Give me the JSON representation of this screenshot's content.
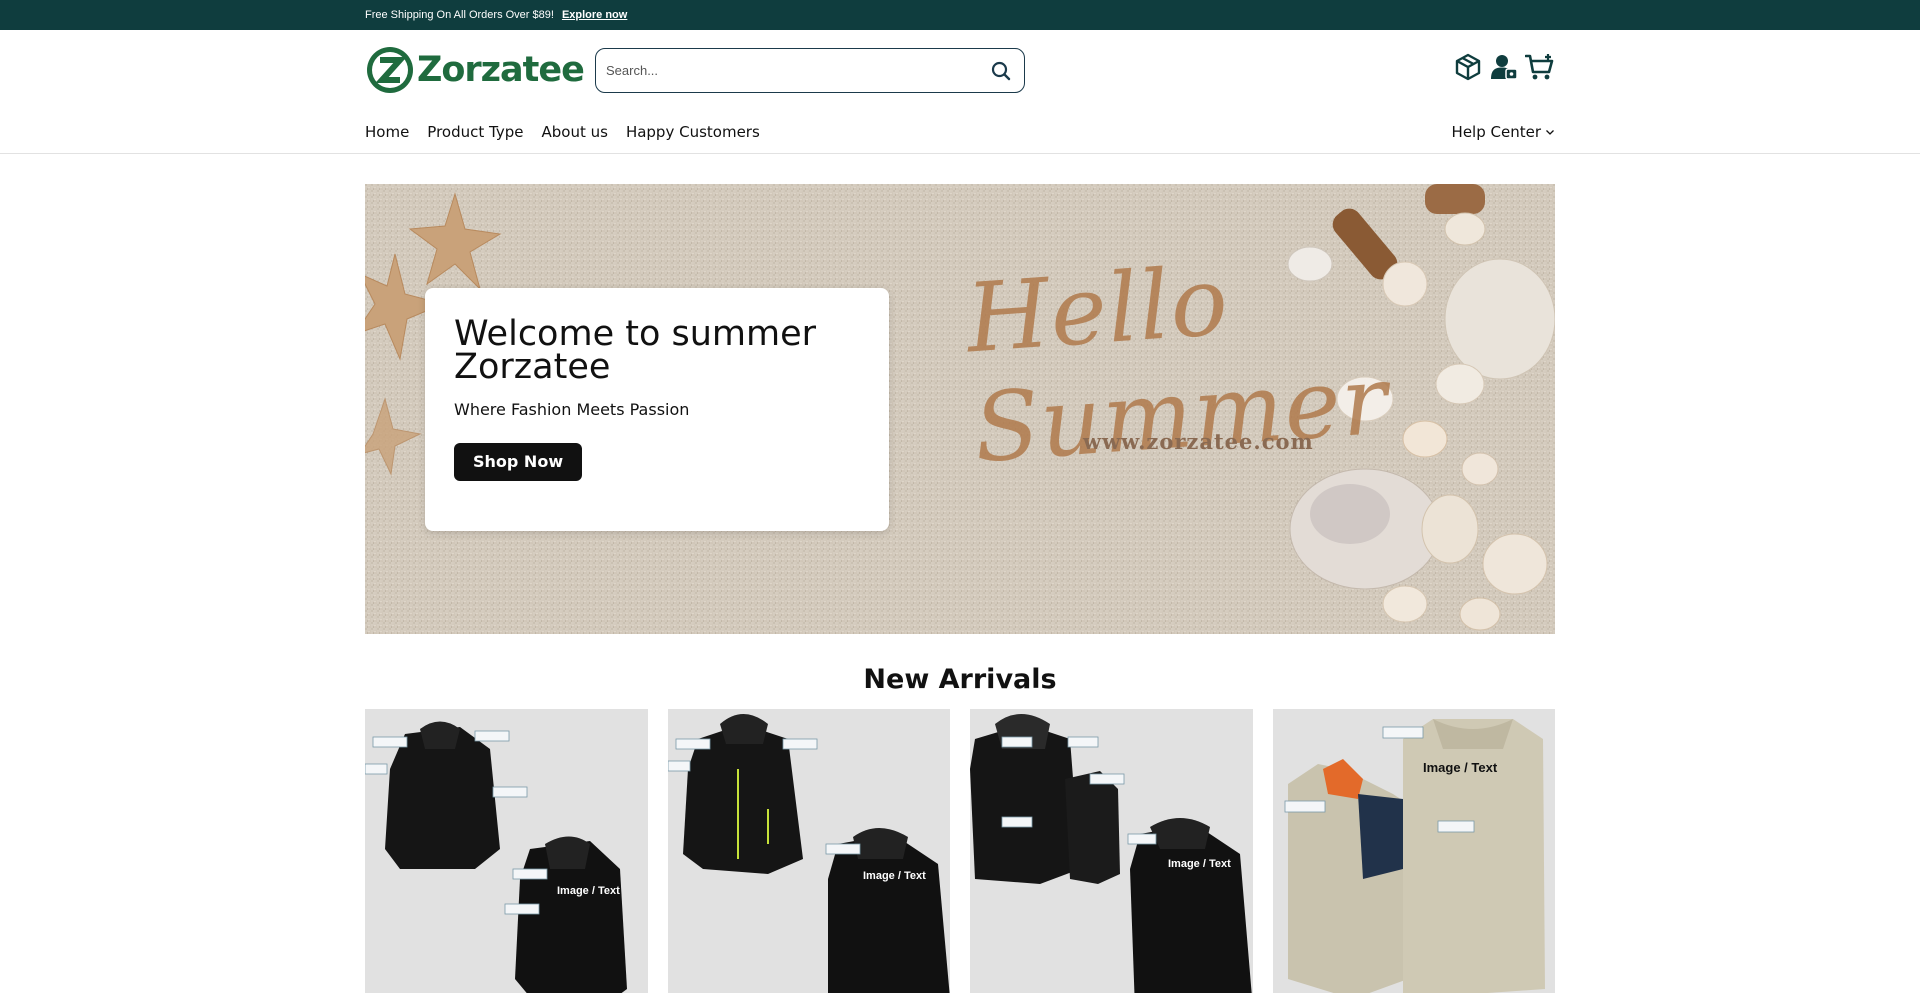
{
  "announcement": {
    "text": "Free Shipping On All Orders Over $89!",
    "link": "Explore now"
  },
  "brand": {
    "name": "Zorzatee",
    "color": "#1f6b3e"
  },
  "search": {
    "placeholder": "Search..."
  },
  "header_icons": [
    "box-icon",
    "account-icon",
    "cart-icon"
  ],
  "nav": {
    "items": [
      "Home",
      "Product Type",
      "About us",
      "Happy Customers"
    ],
    "help": "Help Center"
  },
  "hero": {
    "title": "Welcome to summer Zorzatee",
    "subtitle": "Where Fashion Meets Passion",
    "button": "Shop Now",
    "script_text": "Hello Summer",
    "url_text": "www.zorzatee.com"
  },
  "new_arrivals": {
    "title": "New Arrivals",
    "product_image_label": "Image / Text"
  },
  "colors": {
    "topbar": "#0f3d3e",
    "accent": "#1f6b3e",
    "button": "#111111"
  }
}
